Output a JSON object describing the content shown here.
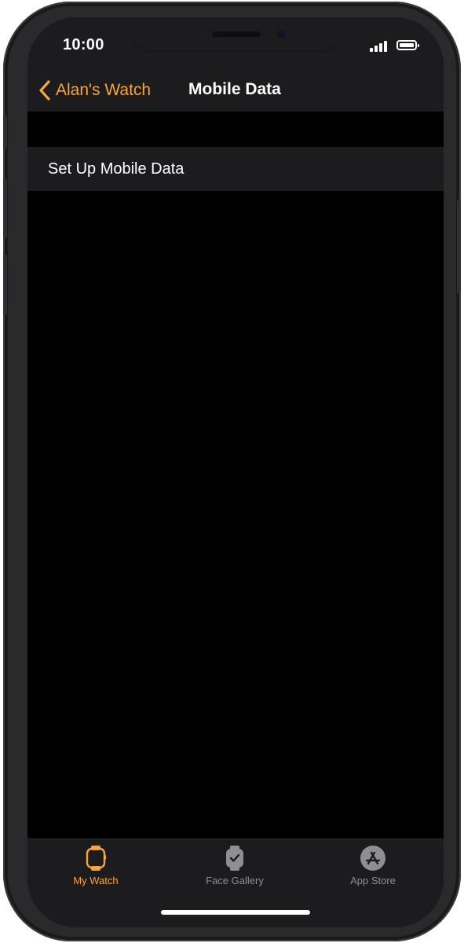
{
  "status_bar": {
    "time": "10:00",
    "signal_icon": "cellular-signal-icon",
    "battery_icon": "battery-icon"
  },
  "nav": {
    "back_label": "Alan's Watch",
    "title": "Mobile Data",
    "back_icon": "chevron-left-icon"
  },
  "list": {
    "rows": [
      {
        "label": "Set Up Mobile Data"
      }
    ]
  },
  "tabbar": {
    "tabs": [
      {
        "label": "My Watch",
        "icon": "watch-icon",
        "selected": true
      },
      {
        "label": "Face Gallery",
        "icon": "watch-face-icon",
        "selected": false
      },
      {
        "label": "App Store",
        "icon": "app-store-icon",
        "selected": false
      }
    ]
  },
  "colors": {
    "accent": "#f7a43c",
    "background": "#000000",
    "surface": "#1c1c1e",
    "inactive": "#8e8e93"
  }
}
